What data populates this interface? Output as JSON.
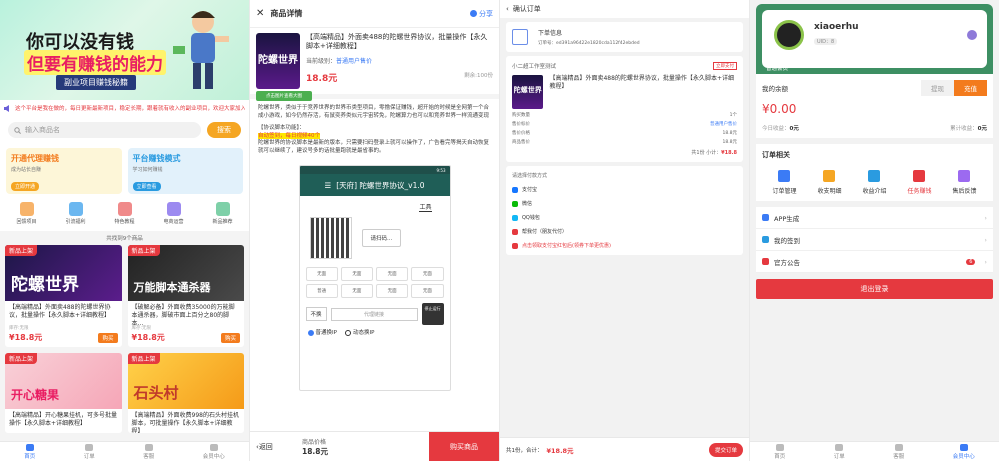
{
  "home": {
    "banner": {
      "line1": "你可以没有钱",
      "line2": "但要有赚钱的能力",
      "line3": "副业项目赚钱秘籍"
    },
    "notice": "这个平台是我在做的，每日更新最新项目，稳定长期，跟着就有收入的副业项目，欢迎大家加入",
    "search": {
      "placeholder": "输入商品名",
      "button": "搜索"
    },
    "cards": [
      {
        "title": "开通代理赚钱",
        "sub": "成为站长自赚",
        "pill": "立即开通"
      },
      {
        "title": "平台赚钱模式",
        "sub": "学习如何赚钱",
        "pill": "立即查看"
      }
    ],
    "icons": [
      "回馈项目",
      "引流福利",
      "特色教程",
      "电商运营",
      "新品推荐"
    ],
    "count": "共找到9个商品",
    "products": [
      {
        "tag": "新品上架",
        "big": "陀螺世界",
        "title": "【高端精品】外面卖488的陀螺世界协议，批量操作【永久脚本+详细教程】",
        "sub": "库存:无限",
        "price": "¥18.8元",
        "buy": "购买"
      },
      {
        "tag": "新品上架",
        "big": "万能脚本通杀器",
        "title": "【破解必备】外面收费35000的万能脚本通杀器，脚破市面上百分之80的脚本...",
        "sub": "库存:无限",
        "price": "¥18.8元",
        "buy": "购买"
      },
      {
        "tag": "新品上架",
        "big": "开心糖果",
        "title": "【高端精品】开心糖果挂机，可多号批量操作【永久脚本+详细教程】",
        "sub": "",
        "price": "",
        "buy": ""
      },
      {
        "tag": "新品上架",
        "big": "石头村",
        "title": "【高端精品】外面收费998的石头村挂机脚本，可批量操作【永久脚本+详细教程】",
        "sub": "",
        "price": "",
        "buy": ""
      }
    ],
    "tabs": [
      "首页",
      "订单",
      "客服",
      "会员中心"
    ]
  },
  "detail": {
    "header": "商品详情",
    "share": "分享",
    "title": "【高端精品】外面卖488的陀螺世界协议，批量操作【永久脚本+详细教程】",
    "level_label": "当前级别：",
    "level": "普通用户售价",
    "price": "18.8元",
    "stock": "剩余:100份",
    "thumb": "陀螺世界",
    "thumb_btn": "点击图片查看大图",
    "desc": "陀螺世界，类似于于竞养世界的世界币类型项目，零撸保证赚钱，超开始的时候是全网第一个合成小游戏，如今仍然存活，有鼠奕养类似元宇宙转免，陀螺算力也可以和竞养世界一样流通变现",
    "func_label": "【协议脚本功能】：",
    "func_hl": "自动签到，每日视频40个",
    "func_more": "陀螺世界的协议脚本是最新的版本，只需要扫码登录上就可以操作了，广告看完等揭天自动恢复就可以继续了，建议号多的话批量跑就是最省事的。",
    "phone": {
      "time": "9:53",
      "appbar": "[天府] 陀螺世界协议_v1.0",
      "tool": "工具",
      "scan": "请扫码...",
      "opts": [
        "无面",
        "无面",
        "无面",
        "无面",
        "普通",
        "无面",
        "无面",
        "无面"
      ],
      "sel": "不换",
      "proxy": "代理链接",
      "stop": "停止运行",
      "radio1": "普通换IP",
      "radio2": "动态换IP"
    },
    "back": "返回",
    "price_label": "商品价格",
    "price_val": "18.8元",
    "buy": "购买商品"
  },
  "order": {
    "header": "确认订单",
    "ordlabel": "下单信息",
    "ordno": "订单号：ed391a96422e1820cda112f42ebded",
    "shop": "小二超工作室测试",
    "shoptag": "立即支付",
    "item_title": "【高端精品】外面卖488的陀螺世界协议，批量操作【永久脚本+详细教程】",
    "thumb": "陀螺世界",
    "kv": [
      [
        "购买数量",
        "1个"
      ],
      [
        "售价标价",
        "普通用户售价"
      ],
      [
        "售价价格",
        "18.8元"
      ],
      [
        "商品售价",
        "18.8元"
      ]
    ],
    "sum_label": "共1份 小计：",
    "sum": "¥18.8",
    "paytitle": "请选择付款方式",
    "payopts": [
      "支付宝",
      "微信",
      "QQ钱包",
      "帮我付（朋友代付）"
    ],
    "payhint": "点击领取支付宝红包后(领券下单更优惠)",
    "total_prefix": "共1份，合计：",
    "total": "¥18.8元",
    "submit": "提交订单"
  },
  "member": {
    "name": "xiaoerhu",
    "uid": "UID：8",
    "level": "普通会员",
    "level_en": "REGULAR MEMBERS",
    "balance_label": "我的余额",
    "tabs": [
      "提现",
      "充值"
    ],
    "money": "¥0.00",
    "today_label": "今日收益：",
    "today": "0元",
    "total_label": "累计收益：",
    "total": "0元",
    "orders_title": "订单相关",
    "orders": [
      "订单管理",
      "收支明细",
      "收益介绍",
      "任务赚钱",
      "售后反馈"
    ],
    "menu": [
      {
        "label": "APP生成",
        "badge": ""
      },
      {
        "label": "我的签到",
        "badge": ""
      },
      {
        "label": "官方公告",
        "badge": "6"
      }
    ],
    "logout": "退出登录",
    "tabs_bottom": [
      "首页",
      "订单",
      "客服",
      "会员中心"
    ]
  },
  "colors": {
    "accent": "#e5393f",
    "orange": "#f37b1d",
    "blue": "#3b7bf5",
    "green": "#3d8f63"
  }
}
